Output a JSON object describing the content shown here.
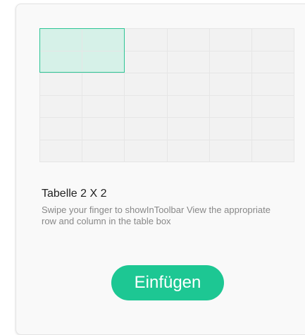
{
  "table_picker": {
    "rows": 6,
    "columns": 6,
    "selected_rows": 2,
    "selected_columns": 2,
    "accent_color": "#1dc793"
  },
  "title": "Tabelle 2 X 2",
  "hint": "Swipe your finger to showInToolbar View the appropriate row and column in the table box",
  "insert_button": {
    "label": "Einfügen"
  }
}
